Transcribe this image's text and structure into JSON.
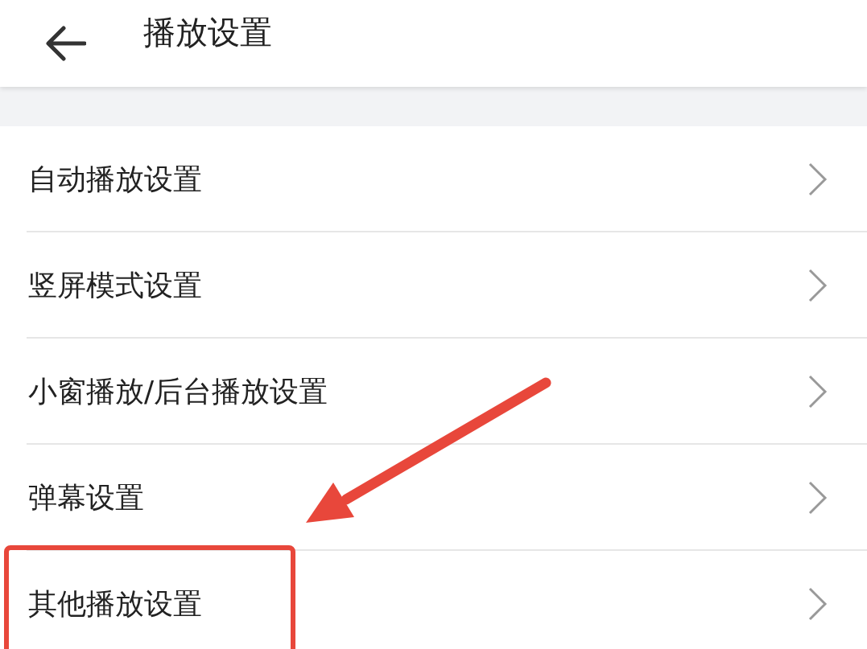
{
  "header": {
    "title": "播放设置"
  },
  "items": [
    {
      "label": "自动播放设置",
      "highlighted": false
    },
    {
      "label": "竖屏模式设置",
      "highlighted": false
    },
    {
      "label": "小窗播放/后台播放设置",
      "highlighted": false
    },
    {
      "label": "弹幕设置",
      "highlighted": false
    },
    {
      "label": "其他播放设置",
      "highlighted": true
    }
  ]
}
